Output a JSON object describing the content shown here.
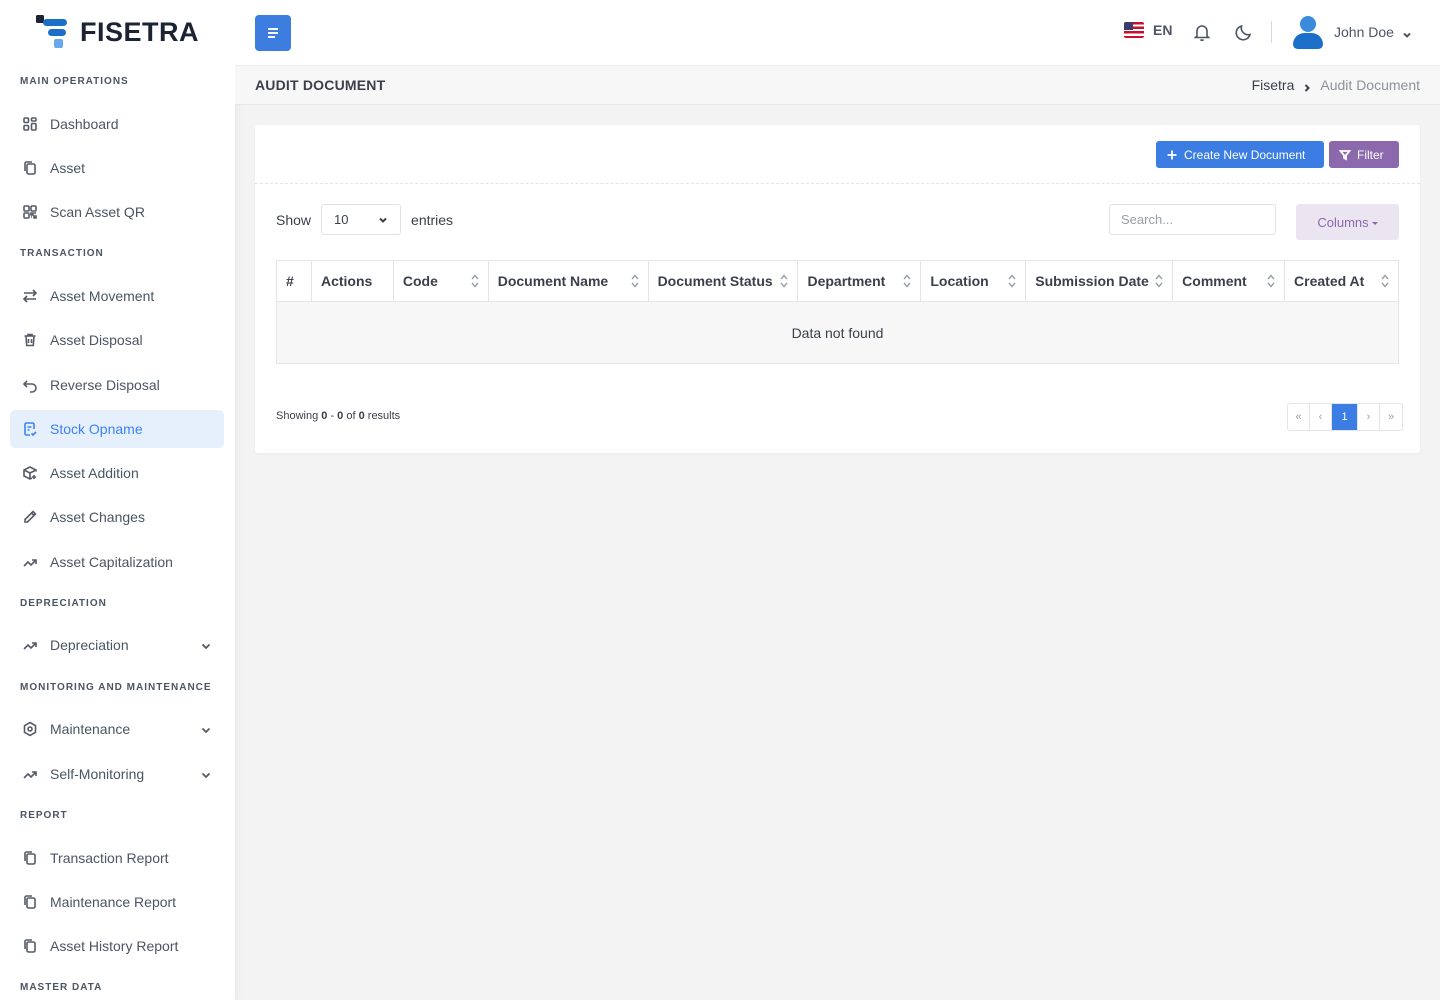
{
  "brand": {
    "name": "FISETRA"
  },
  "sidebar": {
    "sections": {
      "main": "MAIN OPERATIONS",
      "transaction": "TRANSACTION",
      "depreciation": "DEPRECIATION",
      "monitoring": "MONITORING AND MAINTENANCE",
      "report": "REPORT",
      "master": "MASTER DATA"
    },
    "items": {
      "dashboard": "Dashboard",
      "asset": "Asset",
      "scan_qr": "Scan Asset QR",
      "asset_movement": "Asset Movement",
      "asset_disposal": "Asset Disposal",
      "reverse_disposal": "Reverse Disposal",
      "stock_opname": "Stock Opname",
      "asset_addition": "Asset Addition",
      "asset_changes": "Asset Changes",
      "asset_capitalization": "Asset Capitalization",
      "depreciation": "Depreciation",
      "maintenance": "Maintenance",
      "self_monitoring": "Self-Monitoring",
      "transaction_report": "Transaction Report",
      "maintenance_report": "Maintenance Report",
      "asset_history_report": "Asset History Report"
    },
    "active_item": "Stock Opname"
  },
  "topbar": {
    "language": "EN",
    "user_name": "John Doe"
  },
  "page": {
    "title": "AUDIT DOCUMENT",
    "breadcrumb": {
      "home": "Fisetra",
      "current": "Audit Document"
    }
  },
  "toolbar": {
    "create_label": "Create New Document",
    "filter_label": "Filter",
    "show_label": "Show",
    "entries_label": "entries",
    "page_size": "10",
    "search_placeholder": "Search...",
    "columns_label": "Columns"
  },
  "table": {
    "headers": [
      "#",
      "Actions",
      "Code",
      "Document Name",
      "Document Status",
      "Department",
      "Location",
      "Submission Date",
      "Comment",
      "Created At"
    ],
    "empty_text": "Data not found"
  },
  "pagination": {
    "showing_prefix": "Showing",
    "from": "0",
    "to": "0",
    "total": "0",
    "suffix": "results",
    "current_page": "1",
    "first": "«",
    "prev": "‹",
    "next": "›",
    "last": "»"
  },
  "colors": {
    "primary": "#3b7de2",
    "filter": "#8c68ad",
    "active_nav_bg": "#e6f0fd",
    "active_nav_text": "#3b82f6"
  },
  "icons": {
    "dashboard": "grid-icon",
    "asset": "copy-icon",
    "scan_qr": "qr-icon",
    "asset_movement": "arrows-left-right-icon",
    "asset_disposal": "trash-icon",
    "reverse_disposal": "undo-icon",
    "stock_opname": "clipboard-check-icon",
    "asset_addition": "box-plus-icon",
    "asset_changes": "pencil-icon",
    "asset_capitalization": "trend-up-icon",
    "maintenance": "hexagon-gear-icon"
  }
}
